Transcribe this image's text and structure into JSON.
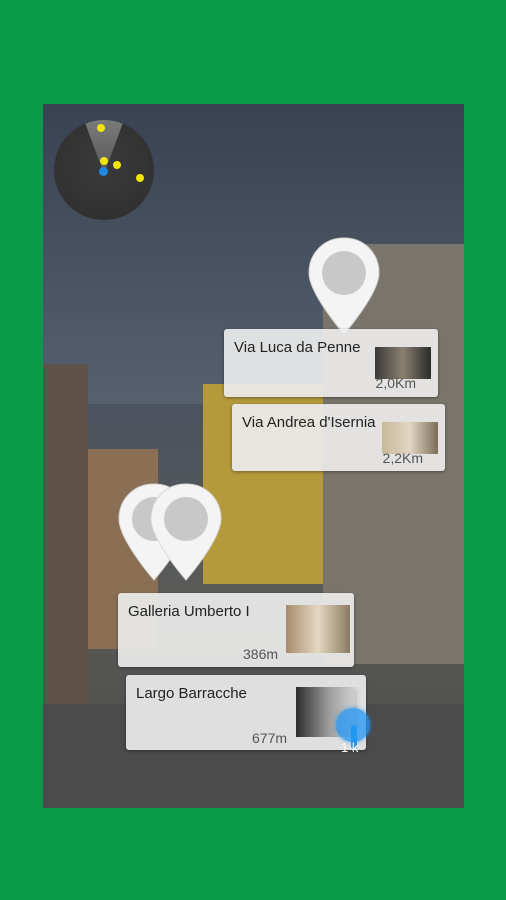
{
  "background_color": "#0b9a48",
  "radar": {
    "icon": "radar-icon",
    "blip_color": "#f2e600",
    "user_color": "#1e88e5"
  },
  "places": [
    {
      "name": "Via Luca da Penne",
      "distance": "2,0Km"
    },
    {
      "name": "Via Andrea d'Isernia",
      "distance": "2,2Km"
    },
    {
      "name": "Galleria Umberto I",
      "distance": "386m"
    },
    {
      "name": "Largo Barracche",
      "distance": "677m"
    }
  ],
  "range_slider": {
    "label": "1 k",
    "accent": "#2196f3",
    "level_fraction": 0.4
  }
}
